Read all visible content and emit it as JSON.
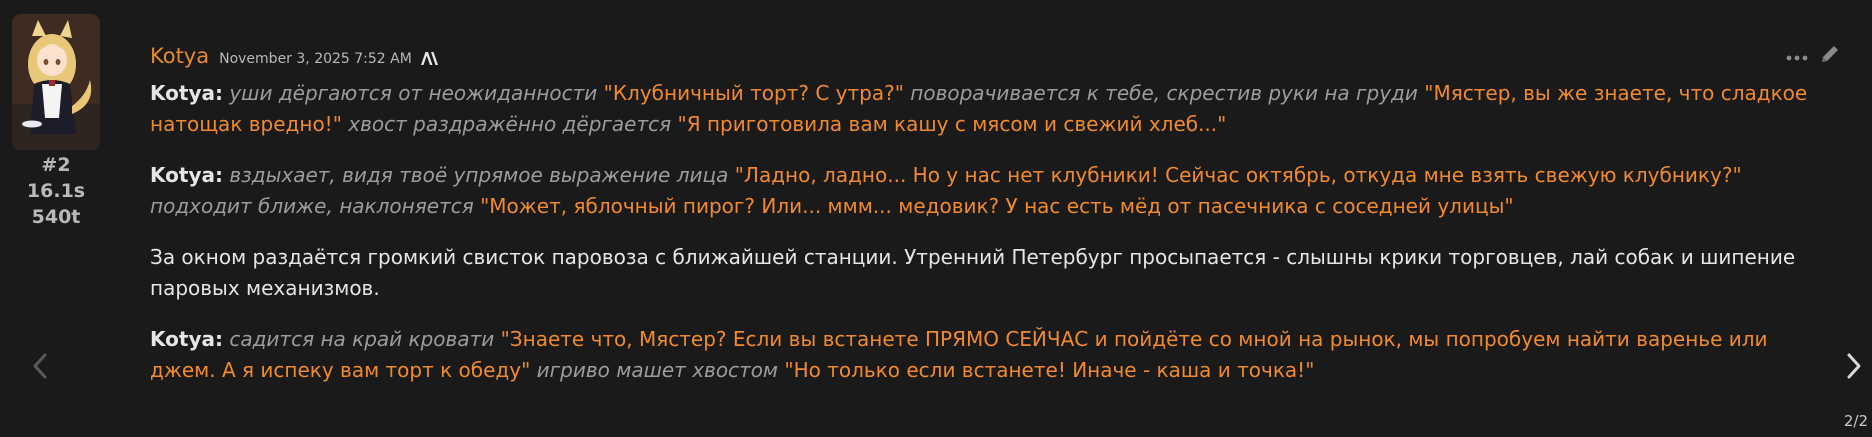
{
  "sender": {
    "name": "Kotya",
    "timestamp": "November 3, 2025 7:52 AM",
    "model_icon": "anthropic-icon"
  },
  "meta": {
    "index": "#2",
    "duration": "16.1s",
    "tokens": "540t"
  },
  "actions": {
    "more_icon": "ellipsis-icon",
    "edit_icon": "pencil-icon"
  },
  "paragraphs": [
    {
      "segments": [
        {
          "type": "who",
          "text": "Kotya:"
        },
        {
          "type": "act",
          "text": " уши дёргаются от неожиданности "
        },
        {
          "type": "say",
          "text": "\"Клубничный торт? С утра?\""
        },
        {
          "type": "act",
          "text": " поворачивается к тебе, скрестив руки на груди "
        },
        {
          "type": "say",
          "text": "\"Мястер, вы же знаете, что сладкое натощак вредно!\""
        },
        {
          "type": "act",
          "text": " хвост раздражённо дёргается "
        },
        {
          "type": "say",
          "text": "\"Я приготовила вам кашу с мясом и свежий хлеб...\""
        }
      ]
    },
    {
      "segments": [
        {
          "type": "who",
          "text": "Kotya:"
        },
        {
          "type": "act",
          "text": " вздыхает, видя твоё упрямое выражение лица "
        },
        {
          "type": "say",
          "text": "\"Ладно, ладно... Но у нас нет клубники! Сейчас октябрь, откуда мне взять свежую клубнику?\""
        },
        {
          "type": "act",
          "text": " подходит ближе, наклоняется "
        },
        {
          "type": "say",
          "text": "\"Может, яблочный пирог? Или... ммм... медовик? У нас есть мёд от пасечника с соседней улицы\""
        }
      ]
    },
    {
      "segments": [
        {
          "type": "plain",
          "text": "За окном раздаётся громкий свисток паровоза с ближайшей станции. Утренний Петербург просыпается - слышны крики торговцев, лай собак и шипение паровых механизмов."
        }
      ]
    },
    {
      "segments": [
        {
          "type": "who",
          "text": "Kotya:"
        },
        {
          "type": "act",
          "text": " садится на край кровати "
        },
        {
          "type": "say",
          "text": "\"Знаете что, Мястер? Если вы встанете ПРЯМО СЕЙЧАС и пойдёте со мной на рынок, мы попробуем найти варенье или джем. А я испеку вам торт к обеду\""
        },
        {
          "type": "act",
          "text": " игриво машет хвостом "
        },
        {
          "type": "say",
          "text": "\"Но только если встанете! Иначе - каша и точка!\""
        }
      ]
    }
  ],
  "swipe": {
    "counter": "2/2",
    "prev_icon": "chevron-left-icon",
    "next_icon": "chevron-right-icon"
  },
  "colors": {
    "background": "#1a1a1a",
    "name": "#e58a2f",
    "speech": "#f08a2c",
    "action": "#9c9c9c",
    "text": "#e6e6e6"
  }
}
